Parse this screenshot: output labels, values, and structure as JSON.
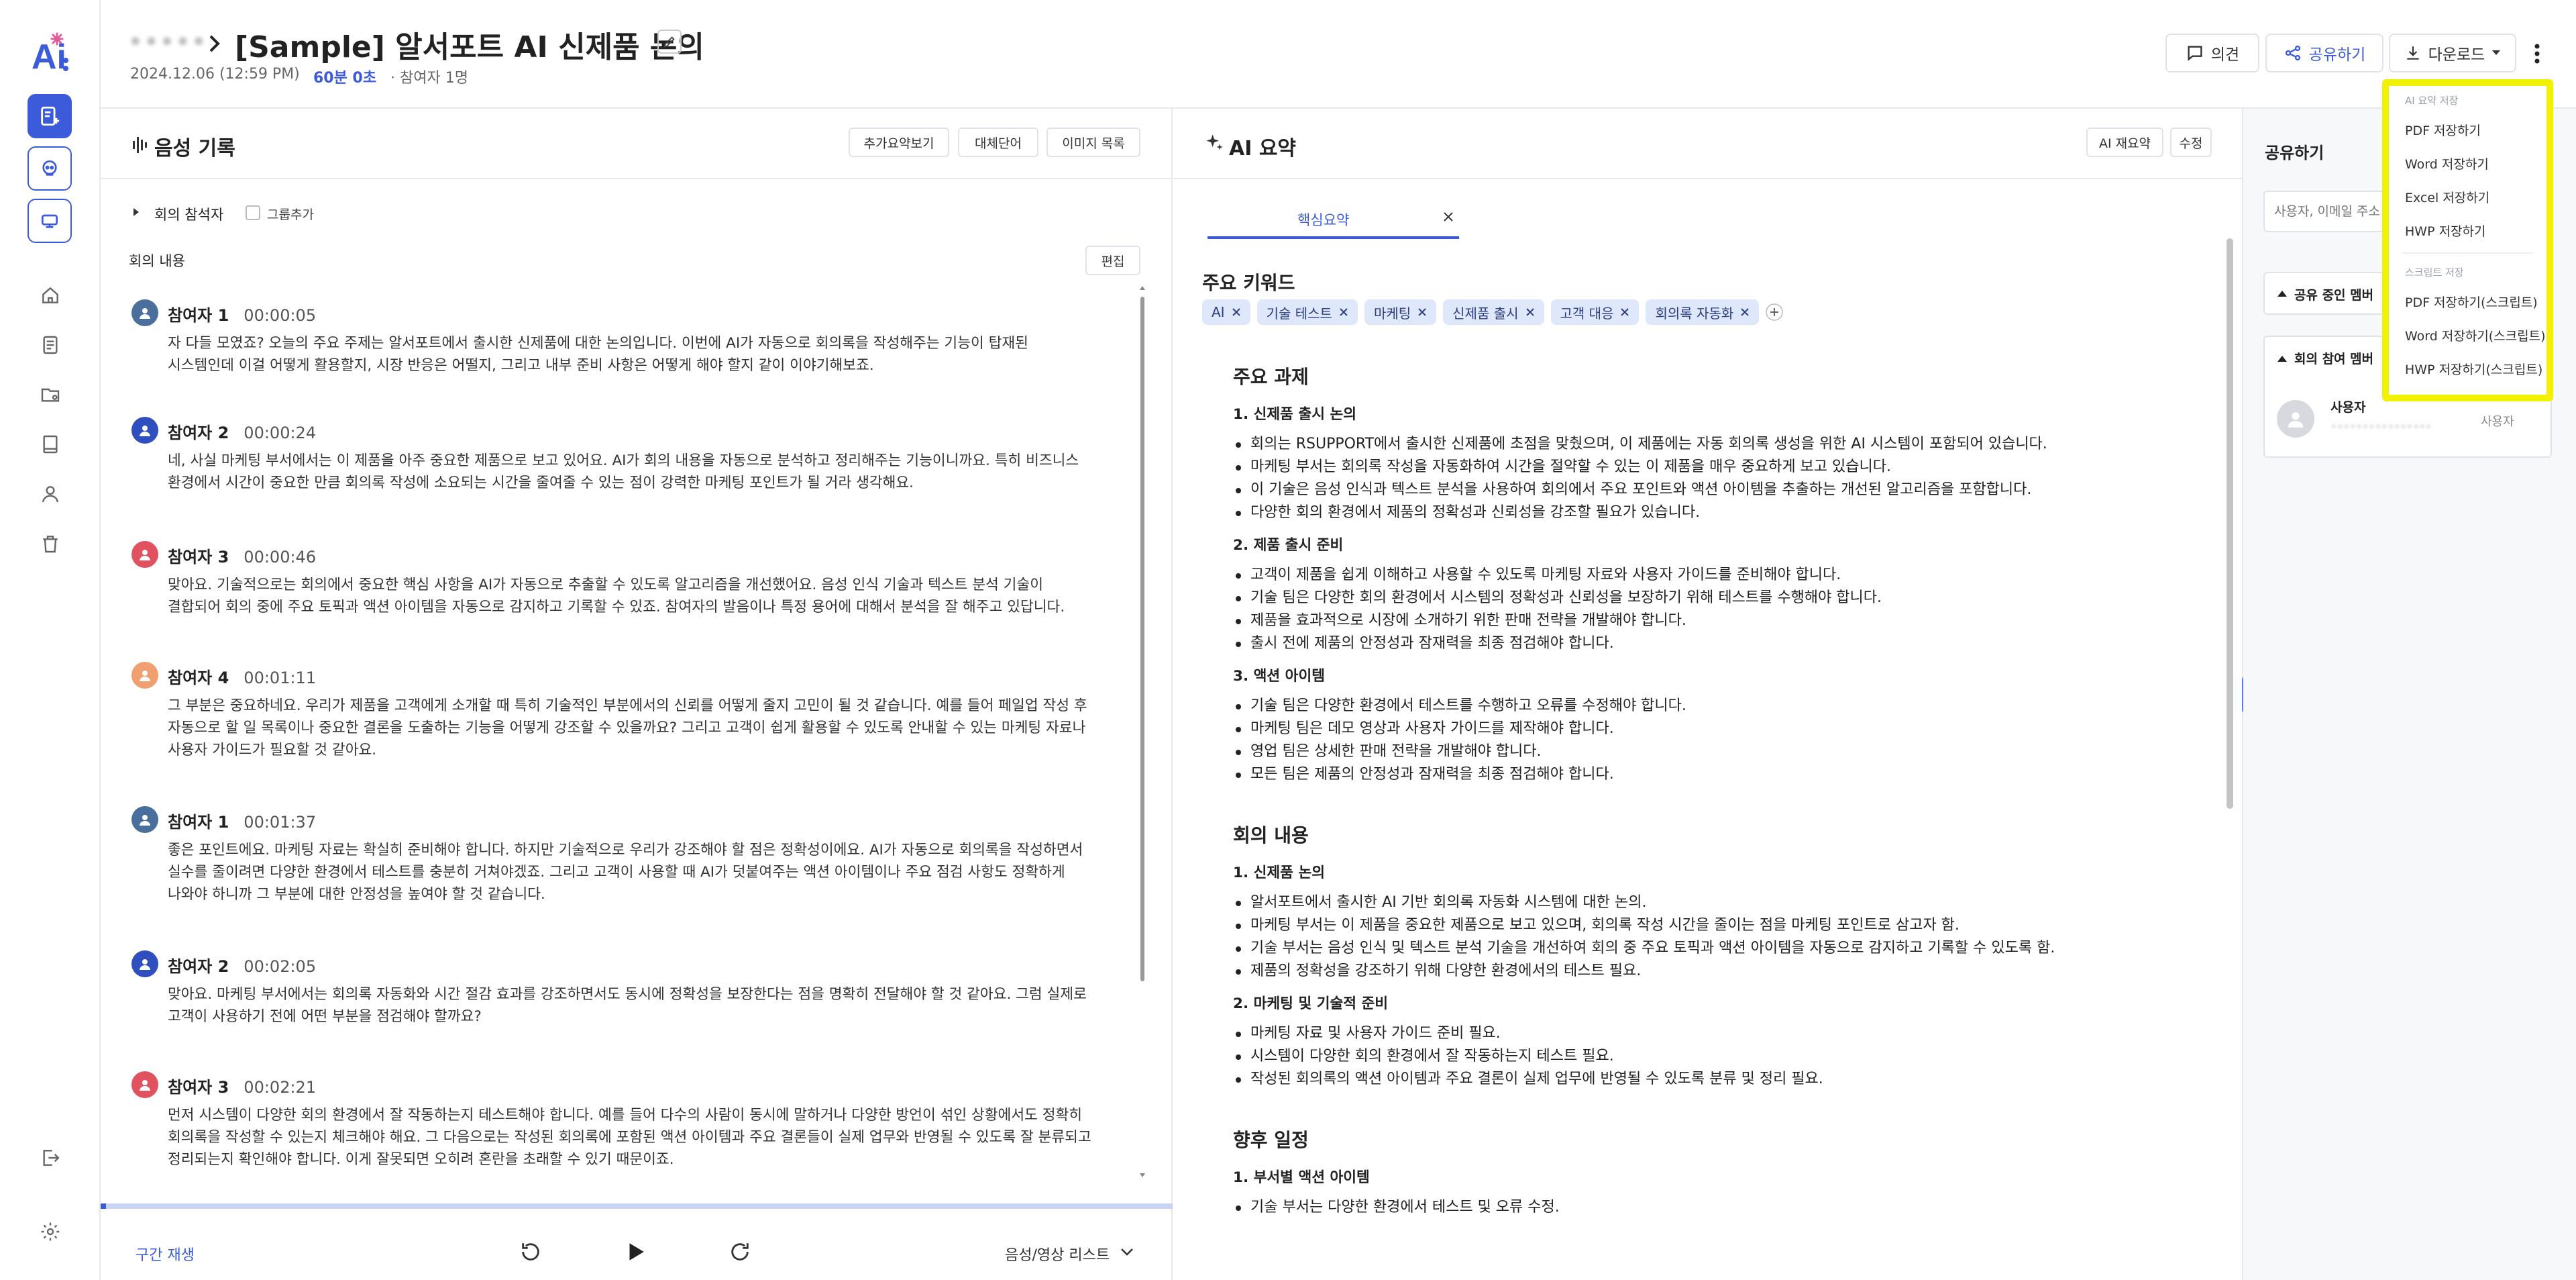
{
  "header": {
    "breadcrumb_parent": "•••••",
    "title": "[Sample] 알서포트 AI 신제품 논의",
    "date": "2024.12.06 (12:59 PM)",
    "duration": "60분 0초",
    "participants": "· 참여자 1명",
    "btn_comment": "의견",
    "btn_share": "공유하기",
    "btn_download": "다운로드"
  },
  "left_panel": {
    "title": "음성 기록",
    "btn_extra_summary": "추가요약보기",
    "btn_alt_words": "대체단어",
    "btn_image_list": "이미지 목록",
    "attendees_label": "회의 참석자",
    "group_add": "그룹추가",
    "content_label": "회의 내용",
    "edit_btn": "편집",
    "entries": [
      {
        "speaker": "참여자 1",
        "time": "00:00:05",
        "color": "#4a6f9c",
        "text": "자 다들 모였죠? 오늘의 주요 주제는 알서포트에서 출시한 신제품에 대한 논의입니다. 이번에 AI가 자동으로 회의록을 작성해주는 기능이 탑재된 시스템인데 이걸 어떻게 활용할지, 시장 반응은 어떨지, 그리고 내부 준비 사항은 어떻게 해야 할지 같이 이야기해보죠."
      },
      {
        "speaker": "참여자 2",
        "time": "00:00:24",
        "color": "#2f4fbf",
        "text": "네, 사실 마케팅 부서에서는 이 제품을 아주 중요한 제품으로 보고 있어요. AI가 회의 내용을 자동으로 분석하고 정리해주는 기능이니까요. 특히 비즈니스 환경에서 시간이 중요한 만큼 회의록 작성에 소요되는 시간을 줄여줄 수 있는 점이 강력한 마케팅 포인트가 될 거라 생각해요."
      },
      {
        "speaker": "참여자 3",
        "time": "00:00:46",
        "color": "#e0525f",
        "text": "맞아요. 기술적으로는 회의에서 중요한 핵심 사항을 AI가 자동으로 추출할 수 있도록 알고리즘을 개선했어요. 음성 인식 기술과 텍스트 분석 기술이 결합되어 회의 중에 주요 토픽과 액션 아이템을 자동으로 감지하고 기록할 수 있죠. 참여자의 발음이나 특정 용어에 대해서 분석을 잘 해주고 있답니다."
      },
      {
        "speaker": "참여자 4",
        "time": "00:01:11",
        "color": "#f0a070",
        "text": "그 부분은 중요하네요. 우리가 제품을 고객에게 소개할 때 특히 기술적인 부분에서의 신뢰를 어떻게 줄지 고민이 될 것 같습니다. 예를 들어 페일업 작성 후 자동으로 할 일 목록이나 중요한 결론을 도출하는 기능을 어떻게 강조할 수 있을까요? 그리고 고객이 쉽게 활용할 수 있도록 안내할 수 있는 마케팅 자료나 사용자 가이드가 필요할 것 같아요."
      },
      {
        "speaker": "참여자 1",
        "time": "00:01:37",
        "color": "#4a6f9c",
        "text": "좋은 포인트에요. 마케팅 자료는 확실히 준비해야 합니다. 하지만 기술적으로 우리가 강조해야 할 점은 정확성이에요. AI가 자동으로 회의록을 작성하면서 실수를 줄이려면 다양한 환경에서 테스트를 충분히 거쳐야겠죠. 그리고 고객이 사용할 때 AI가 덧붙여주는 액션 아이템이나 주요 점검 사항도 정확하게 나와야 하니까 그 부분에 대한 안정성을 높여야 할 것 같습니다."
      },
      {
        "speaker": "참여자 2",
        "time": "00:02:05",
        "color": "#2f4fbf",
        "text": "맞아요. 마케팅 부서에서는 회의록 자동화와 시간 절감 효과를 강조하면서도 동시에 정확성을 보장한다는 점을 명확히 전달해야 할 것 같아요. 그럼 실제로 고객이 사용하기 전에 어떤 부분을 점검해야 할까요?"
      },
      {
        "speaker": "참여자 3",
        "time": "00:02:21",
        "color": "#e0525f",
        "text": "먼저 시스템이 다양한 회의 환경에서 잘 작동하는지 테스트해야 합니다. 예를 들어 다수의 사람이 동시에 말하거나 다양한 방언이 섞인 상황에서도 정확히 회의록을 작성할 수 있는지 체크해야 해요. 그 다음으로는 작성된 회의록에 포함된 액션 아이템과 주요 결론들이 실제 업무와 반영될 수 있도록 잘 분류되고 정리되는지 확인해야 합니다. 이게 잘못되면 오히려 혼란을 초래할 수 있기 때문이죠."
      }
    ],
    "footer": {
      "section_play": "구간 재생",
      "media_list": "음성/영상 리스트"
    }
  },
  "center_panel": {
    "title": "AI 요약",
    "btn_resummary": "AI 재요약",
    "btn_edit": "수정",
    "tab": "핵심요약",
    "keywords_title": "주요 키워드",
    "keywords": [
      "AI",
      "기술 테스트",
      "마케팅",
      "신제품 출시",
      "고객 대응",
      "회의록 자동화"
    ],
    "sections": [
      {
        "heading": "주요 과제",
        "groups": [
          {
            "sub": "1. 신제품 출시 논의",
            "items": [
              "회의는 RSUPPORT에서 출시한 신제품에 초점을 맞췄으며, 이 제품에는 자동 회의록 생성을 위한 AI 시스템이 포함되어 있습니다.",
              "마케팅 부서는 회의록 작성을 자동화하여 시간을 절약할 수 있는 이 제품을 매우 중요하게 보고 있습니다.",
              "이 기술은 음성 인식과 텍스트 분석을 사용하여 회의에서 주요 포인트와 액션 아이템을 추출하는 개선된 알고리즘을 포함합니다.",
              "다양한 회의 환경에서 제품의 정확성과 신뢰성을 강조할 필요가 있습니다."
            ]
          },
          {
            "sub": "2. 제품 출시 준비",
            "items": [
              "고객이 제품을 쉽게 이해하고 사용할 수 있도록 마케팅 자료와 사용자 가이드를 준비해야 합니다.",
              "기술 팀은 다양한 회의 환경에서 시스템의 정확성과 신뢰성을 보장하기 위해 테스트를 수행해야 합니다.",
              "제품을 효과적으로 시장에 소개하기 위한 판매 전략을 개발해야 합니다.",
              "출시 전에 제품의 안정성과 잠재력을 최종 점검해야 합니다."
            ]
          },
          {
            "sub": "3. 액션 아이템",
            "items": [
              "기술 팀은 다양한 환경에서 테스트를 수행하고 오류를 수정해야 합니다.",
              "마케팅 팀은 데모 영상과 사용자 가이드를 제작해야 합니다.",
              "영업 팀은 상세한 판매 전략을 개발해야 합니다.",
              "모든 팀은 제품의 안정성과 잠재력을 최종 점검해야 합니다."
            ]
          }
        ]
      },
      {
        "heading": "회의 내용",
        "groups": [
          {
            "sub": "1. 신제품 논의",
            "items": [
              "알서포트에서 출시한 AI 기반 회의록 자동화 시스템에 대한 논의.",
              "마케팅 부서는 이 제품을 중요한 제품으로 보고 있으며, 회의록 작성 시간을 줄이는 점을 마케팅 포인트로 삼고자 함.",
              "기술 부서는 음성 인식 및 텍스트 분석 기술을 개선하여 회의 중 주요 토픽과 액션 아이템을 자동으로 감지하고 기록할 수 있도록 함.",
              "제품의 정확성을 강조하기 위해 다양한 환경에서의 테스트 필요."
            ]
          },
          {
            "sub": "2. 마케팅 및 기술적 준비",
            "items": [
              "마케팅 자료 및 사용자 가이드 준비 필요.",
              "시스템이 다양한 회의 환경에서 잘 작동하는지 테스트 필요.",
              "작성된 회의록의 액션 아이템과 주요 결론이 실제 업무에 반영될 수 있도록 분류 및 정리 필요."
            ]
          }
        ]
      },
      {
        "heading": "향후 일정",
        "groups": [
          {
            "sub": "1. 부서별 액션 아이템",
            "items": [
              "기술 부서는 다양한 환경에서 테스트 및 오류 수정."
            ]
          }
        ]
      }
    ]
  },
  "right_panel": {
    "title": "공유하기",
    "search_placeholder": "사용자, 이메일 주소",
    "sharing_members": "공유 중인 멤버",
    "meeting_members": "회의 참여 멤버",
    "user_name": "사용자",
    "user_sub": "••••••••••••••••",
    "user_role": "사용자"
  },
  "dropdown": {
    "section1": "AI 요약 저장",
    "items1": [
      "PDF 저장하기",
      "Word 저장하기",
      "Excel 저장하기",
      "HWP 저장하기"
    ],
    "section2": "스크립트 저장",
    "items2": [
      "PDF 저장하기(스크립트)",
      "Word 저장하기(스크립트)",
      "HWP 저장하기(스크립트)"
    ],
    "highlight_color": "#f2f200"
  },
  "colors": {
    "accent": "#3b5bdb",
    "rail_active_bg": "#3b5bdb"
  },
  "icons": [
    "ai-logo",
    "new-note-icon",
    "robot-icon",
    "sync-icon",
    "home-icon",
    "document-icon",
    "folder-icon",
    "book-icon",
    "user-icon",
    "trash-icon",
    "logout-icon",
    "gear-icon"
  ]
}
